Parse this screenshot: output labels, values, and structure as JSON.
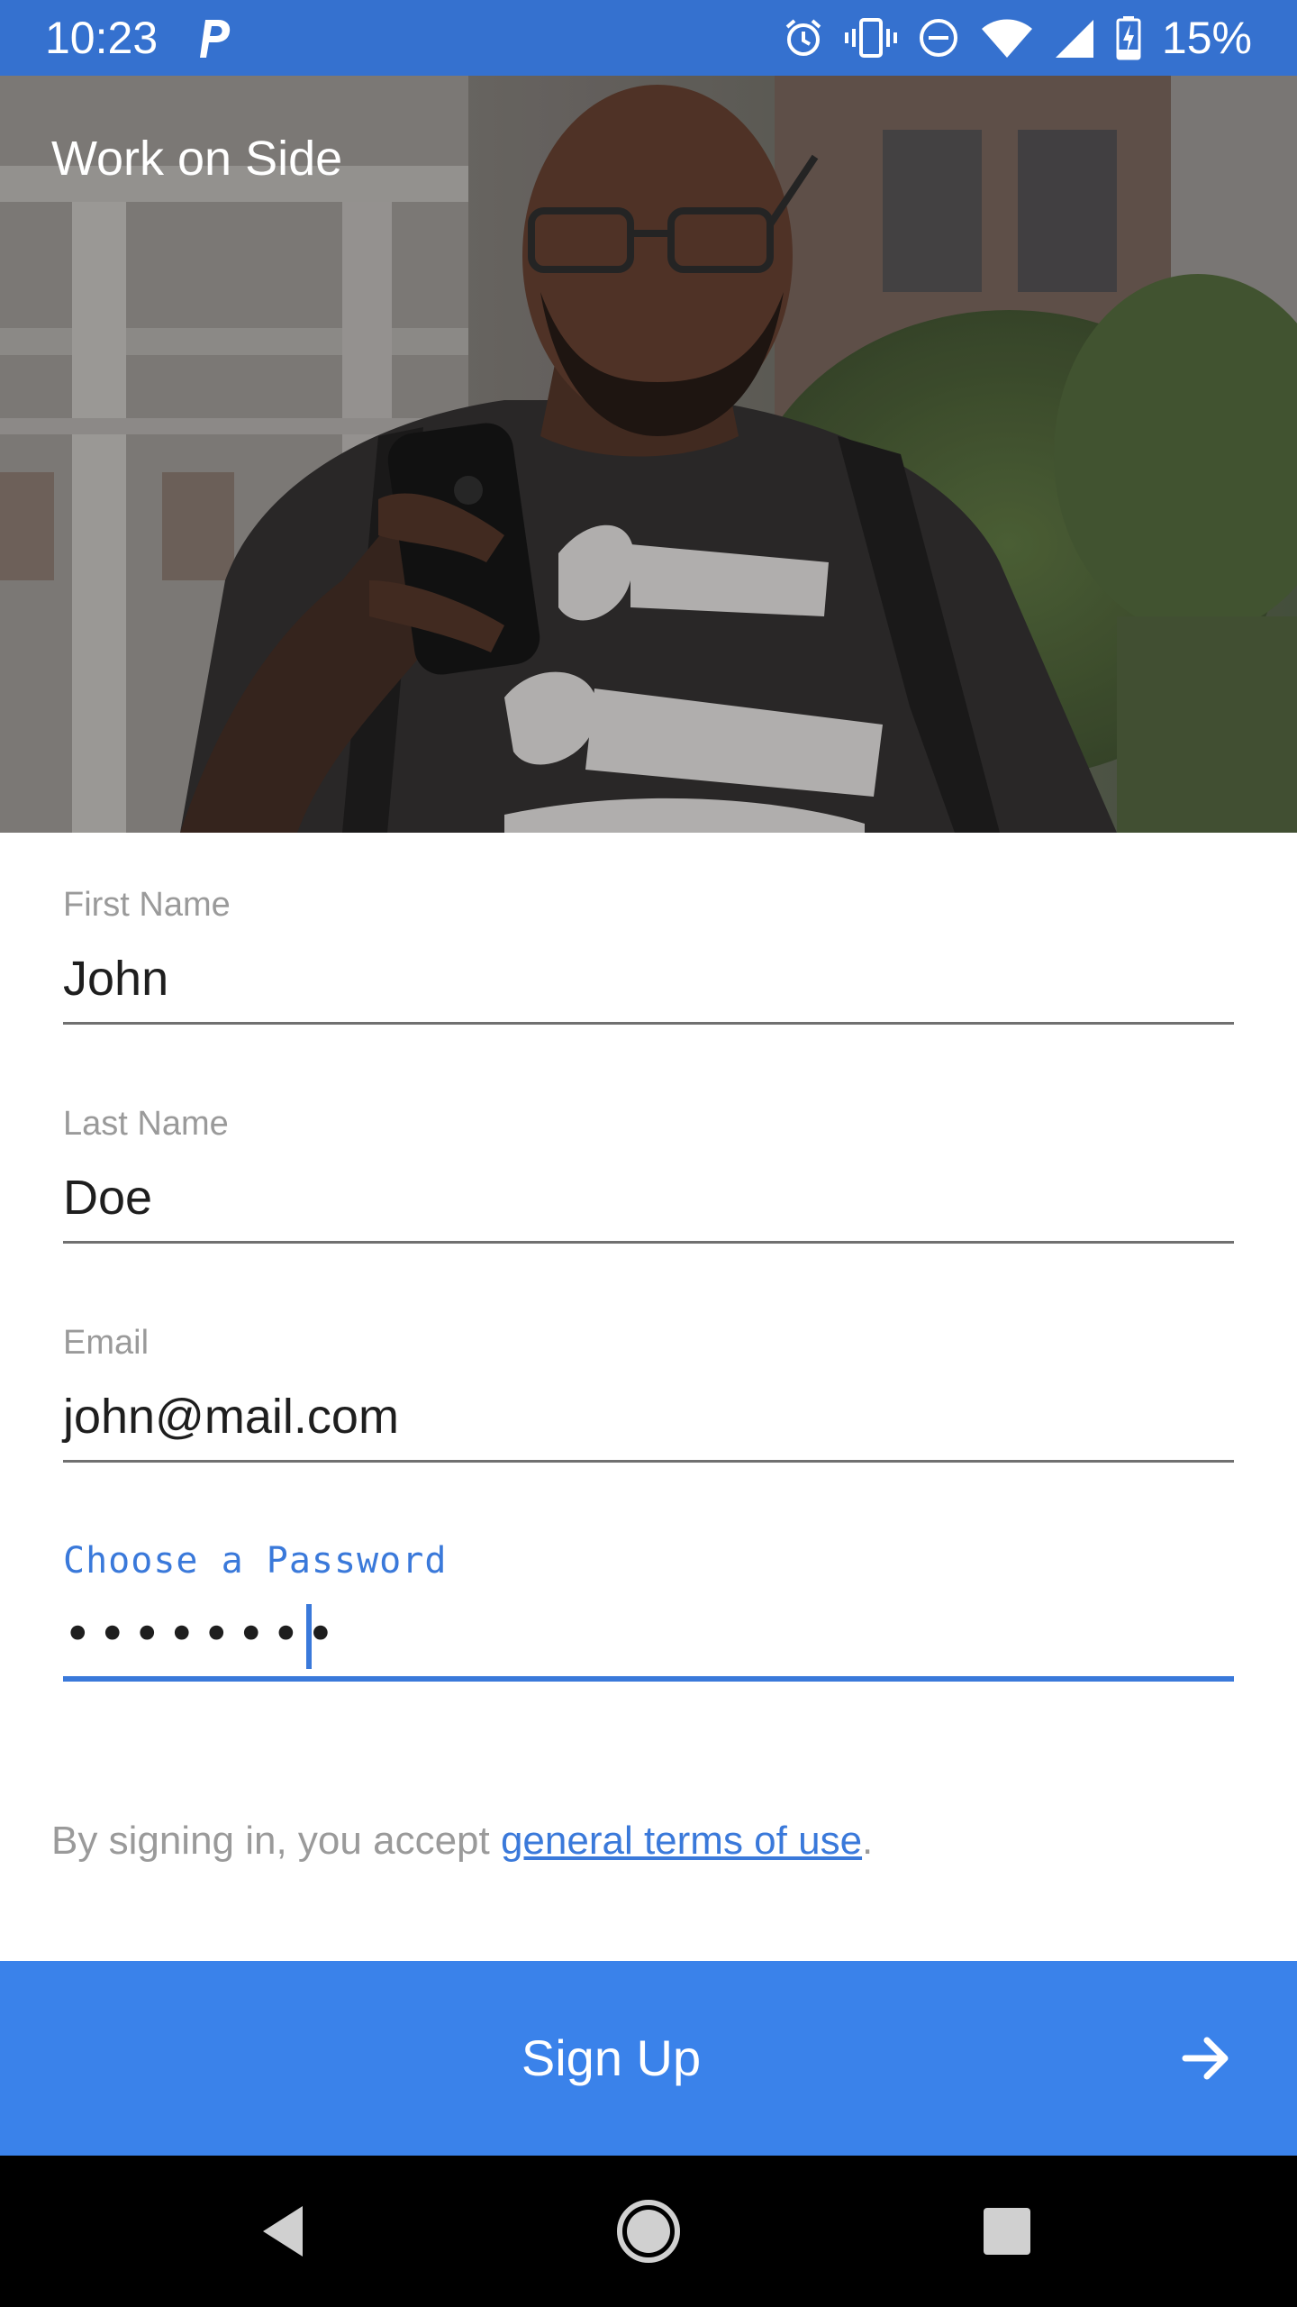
{
  "status_bar": {
    "time": "10:23",
    "battery_percent": "15%",
    "notification_icons": [
      "parking-app-icon"
    ],
    "system_icons": [
      "alarm-icon",
      "vibrate-icon",
      "do-not-disturb-icon",
      "wifi-icon",
      "cell-signal-icon",
      "battery-charging-icon"
    ],
    "background_color": "#3571cf"
  },
  "hero": {
    "title": "Work on Side"
  },
  "form": {
    "fields": [
      {
        "label": "First Name",
        "value": "John"
      },
      {
        "label": "Last Name",
        "value": "Doe"
      },
      {
        "label": "Email",
        "value": "john@mail.com"
      },
      {
        "label": "Choose a Password",
        "value": "••••••••",
        "focused": true
      }
    ]
  },
  "terms": {
    "prefix": "By signing in, you accept ",
    "link": "general terms of use",
    "suffix": "."
  },
  "signup_button": {
    "label": "Sign Up",
    "icon": "arrow-right-icon",
    "color": "#3a82ea"
  },
  "nav_bar": {
    "buttons": [
      "back-icon",
      "home-icon",
      "recents-icon"
    ]
  },
  "colors": {
    "accent": "#3a79da",
    "label_gray": "#9a9a9a"
  }
}
